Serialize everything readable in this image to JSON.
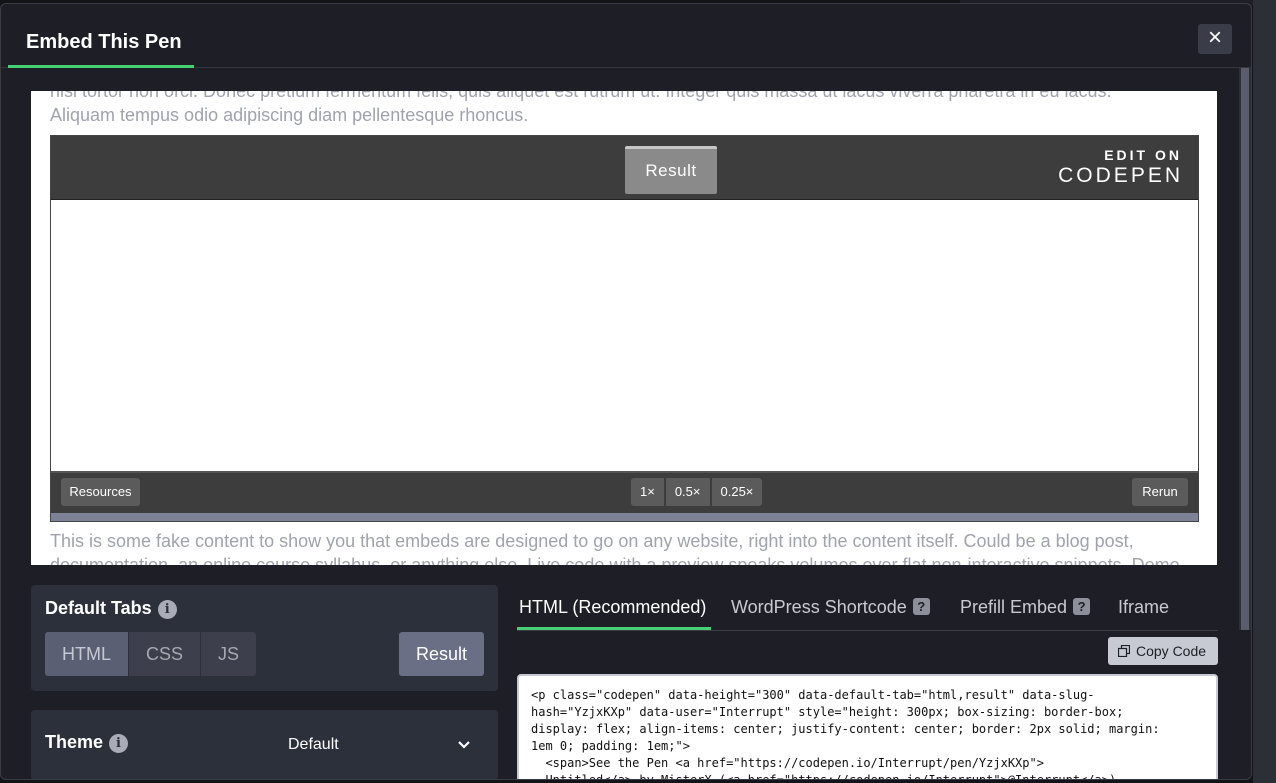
{
  "modal": {
    "title": "Embed This Pen",
    "close_label": "×"
  },
  "preview": {
    "text_top_1": "nisi tortor non orci. Donec pretium fermentum felis, quis aliquet est rutrum ut. Integer quis massa ut lacus viverra pharetra in eu lacus.",
    "text_top_2": "Aliquam tempus odio adipiscing diam pellentesque rhoncus.",
    "text_bottom_1": "This is some fake content to show you that embeds are designed to go on any website, right into the content itself. Could be a blog post,",
    "text_bottom_2": "documentation, an online course syllabus, or anything else. Live code with a preview speaks volumes over flat non-interactive snippets. Demo",
    "embed": {
      "result_tab": "Result",
      "edit_on": "EDIT ON",
      "codepen_wordmark": "CODEPEN",
      "resources_label": "Resources",
      "rerun_label": "Rerun",
      "zoom_options": [
        "1×",
        "0.5×",
        "0.25×"
      ]
    }
  },
  "default_tabs": {
    "label": "Default Tabs",
    "info_icon": "i",
    "options": [
      "HTML",
      "CSS",
      "JS"
    ],
    "active": "HTML",
    "result_label": "Result"
  },
  "theme": {
    "label": "Theme",
    "info_icon": "i",
    "value": "Default"
  },
  "code_tabs": {
    "tabs": [
      "HTML (Recommended)",
      "WordPress Shortcode",
      "Prefill Embed",
      "Iframe"
    ],
    "help_icon": "?",
    "active": "HTML (Recommended)",
    "copy_label": "Copy Code",
    "code_lines": [
      "<p class=\"codepen\" data-height=\"300\" data-default-tab=\"html,result\" data-slug-",
      "hash=\"YzjxKXp\" data-user=\"Interrupt\" style=\"height: 300px; box-sizing: border-box;",
      "display: flex; align-items: center; justify-content: center; border: 2px solid; margin:",
      "1em 0; padding: 1em;\">",
      "  <span>See the Pen <a href=\"https://codepen.io/Interrupt/pen/YzjxKXp\">",
      "  Untitled</a> by MisterX (<a href=\"https://codepen.io/Interrupt\">@Interrupt</a>)"
    ]
  },
  "colors": {
    "accent_green": "#47cf73",
    "modal_bg": "#1e1f26",
    "panel_bg": "#2c303a"
  }
}
